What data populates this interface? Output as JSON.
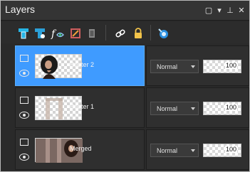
{
  "title": "Layers",
  "window_buttons": [
    "restore-icon",
    "dropdown-icon",
    "pin-icon",
    "close-icon"
  ],
  "toolbar": {
    "icons": [
      "new-raster-layer-icon",
      "new-vector-layer-icon",
      "fx-layer-icon",
      "adjustment-layer-icon",
      "duplicate-layer-icon",
      "link-layers-icon",
      "lock-layer-icon",
      "layer-properties-icon"
    ]
  },
  "layers": [
    {
      "name": "Raster 2",
      "blend_mode": "Normal",
      "opacity": "100",
      "selected": true
    },
    {
      "name": "Raster 1",
      "blend_mode": "Normal",
      "opacity": "100",
      "selected": false
    },
    {
      "name": "Merged",
      "blend_mode": "Normal",
      "opacity": "100",
      "selected": false
    }
  ],
  "colors": {
    "selected_row": "#3f9bff",
    "panel_bg": "#2a2a2a",
    "title_bg": "#343434"
  }
}
